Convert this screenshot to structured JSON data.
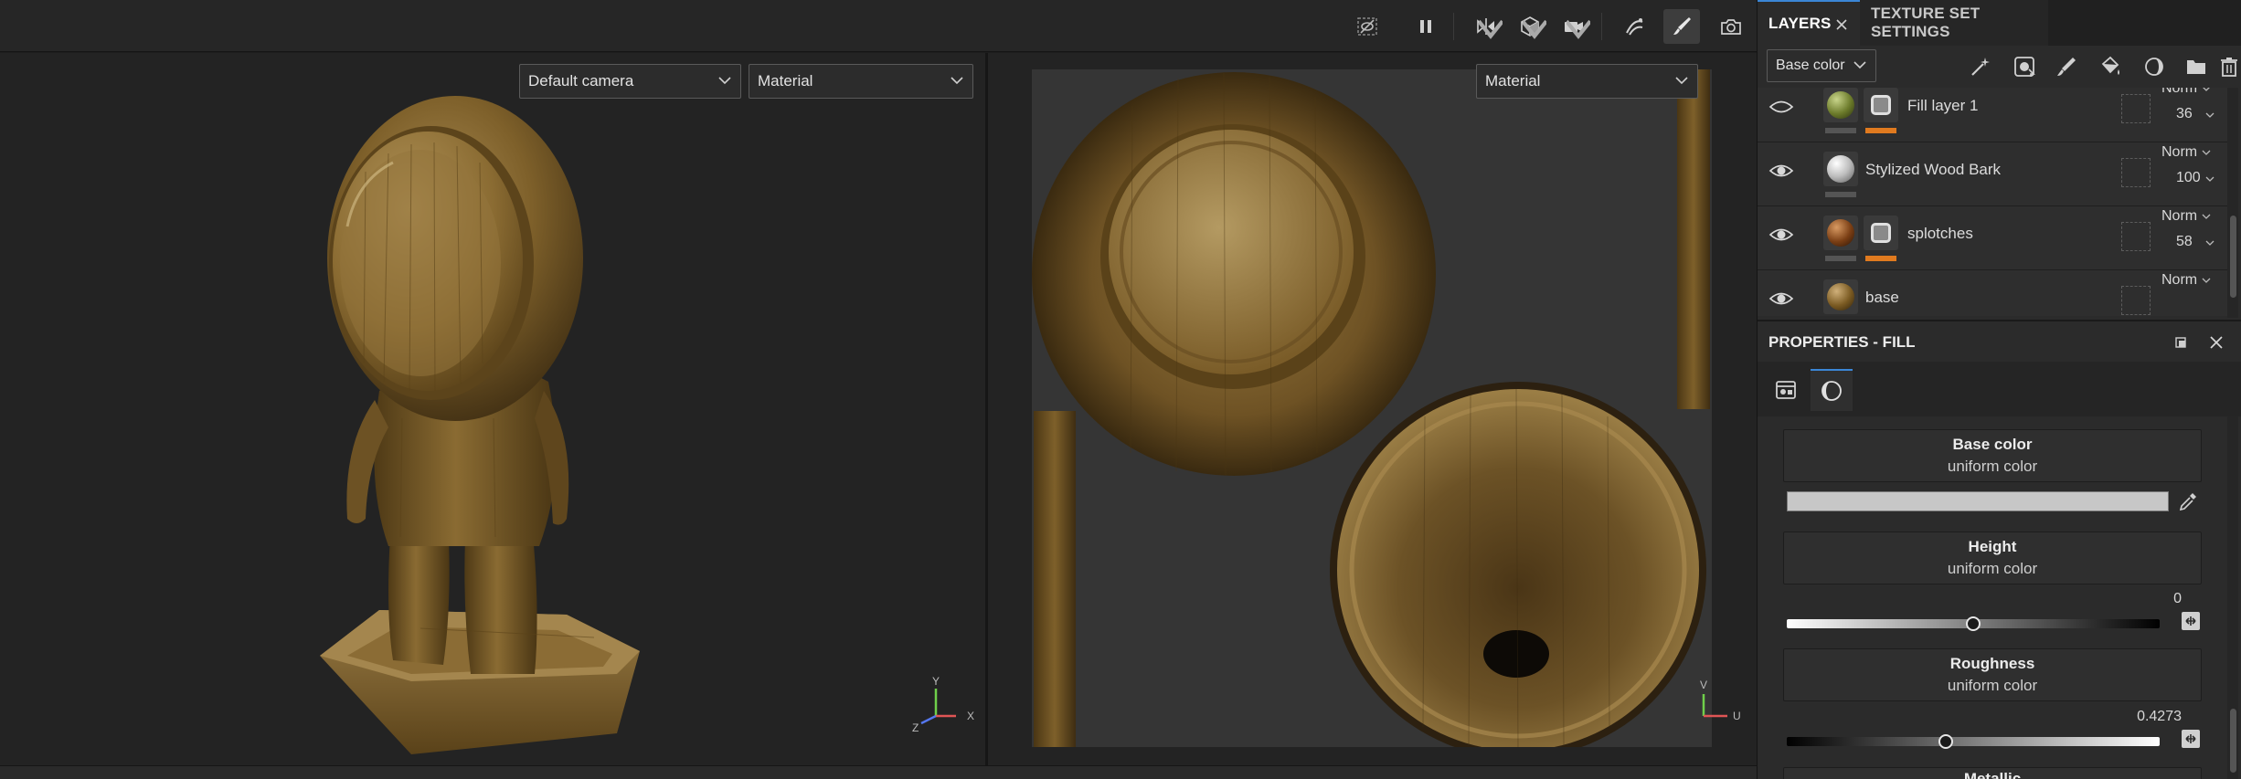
{
  "toolbar": {
    "icons": [
      "hide-icon",
      "pause-icon",
      "symmetry-icon",
      "display-mode-icon",
      "camera-icon",
      "bake-icon",
      "paint-brush-icon",
      "screenshot-icon"
    ]
  },
  "viewport3d": {
    "camera_dropdown": "Default camera",
    "mode_dropdown": "Material",
    "axis": {
      "y": "Y",
      "x": "X",
      "z": "Z"
    }
  },
  "viewport2d": {
    "mode_dropdown": "Material",
    "axis": {
      "v": "V",
      "u": "U"
    }
  },
  "panel": {
    "tabs": [
      {
        "label": "LAYERS",
        "active": true
      },
      {
        "label": "TEXTURE SET SETTINGS",
        "active": false
      }
    ],
    "channel_dropdown": "Base color",
    "layers": [
      {
        "name": "Fill layer 1",
        "blend": "Norm",
        "opacity": "36",
        "thumb_color": "#6b7a2a",
        "has_mask": true,
        "bar_color": "#e07a1f"
      },
      {
        "name": "Stylized Wood Bark",
        "blend": "Norm",
        "opacity": "100",
        "thumb_color": "#bdbdbd",
        "has_mask": false,
        "bar_color": "#555555"
      },
      {
        "name": "splotches",
        "blend": "Norm",
        "opacity": "58",
        "thumb_color": "#7a3e14",
        "has_mask": true,
        "bar_color": "#e07a1f"
      },
      {
        "name": "base",
        "blend": "Norm",
        "opacity": "",
        "thumb_color": "#7a5a22",
        "has_mask": false,
        "bar_color": "#555555"
      }
    ]
  },
  "properties": {
    "title": "PROPERTIES - FILL",
    "channels": [
      {
        "title": "Base color",
        "sub": "uniform color"
      },
      {
        "title": "Height",
        "sub": "uniform color",
        "value": "0",
        "fraction": 0.5
      },
      {
        "title": "Roughness",
        "sub": "uniform color",
        "value": "0.4273",
        "fraction": 0.4273
      }
    ],
    "next_channel_partial": "Metallic"
  },
  "colors": {
    "accent": "#3b86d6",
    "mask_bar": "#e07a1f",
    "wood": "#7a5a22"
  }
}
